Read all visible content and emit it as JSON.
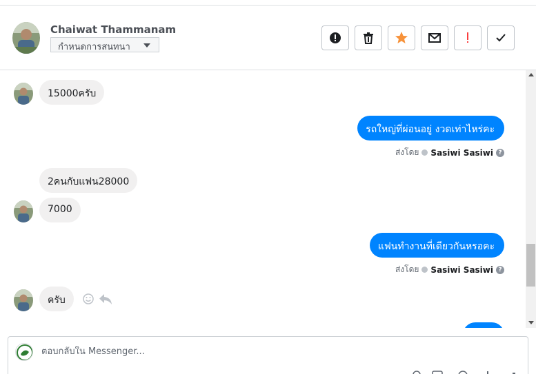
{
  "conversation": {
    "contact_name": "Chaiwat Thammanam",
    "label_select": "กำหนดการสนทนา"
  },
  "toolbar": {
    "buttons": [
      {
        "name": "spam-alert",
        "icon": "alert-circle-icon"
      },
      {
        "name": "delete",
        "icon": "trash-icon"
      },
      {
        "name": "star",
        "icon": "star-icon",
        "color": "#f7923a"
      },
      {
        "name": "mark-unread",
        "icon": "envelope-icon"
      },
      {
        "name": "follow-up",
        "icon": "exclamation-icon",
        "color": "#fa3e3e"
      },
      {
        "name": "mark-done",
        "icon": "check-icon"
      }
    ]
  },
  "messages": [
    {
      "direction": "in",
      "text": "15000ครับ"
    },
    {
      "direction": "out",
      "text": "รถใหญ่ที่ผ่อนอยู่ งวดเท่าไหร่คะ",
      "sent_by_label": "ส่งโดย",
      "sender": "Sasiwi Sasiwi"
    },
    {
      "direction": "in",
      "text": "2คนกับแฟน28000"
    },
    {
      "direction": "in",
      "text": "7000"
    },
    {
      "direction": "out",
      "text": "แฟนทำงานที่เดียวกันหรอคะ",
      "sent_by_label": "ส่งโดย",
      "sender": "Sasiwi Sasiwi"
    },
    {
      "direction": "in",
      "text": "ครับ"
    }
  ],
  "reply": {
    "placeholder": "ตอบกลับใน Messenger..."
  },
  "colors": {
    "accent": "#0084ff",
    "incoming_bubble": "#f1f0f0",
    "star": "#f7923a",
    "alert": "#fa3e3e"
  }
}
